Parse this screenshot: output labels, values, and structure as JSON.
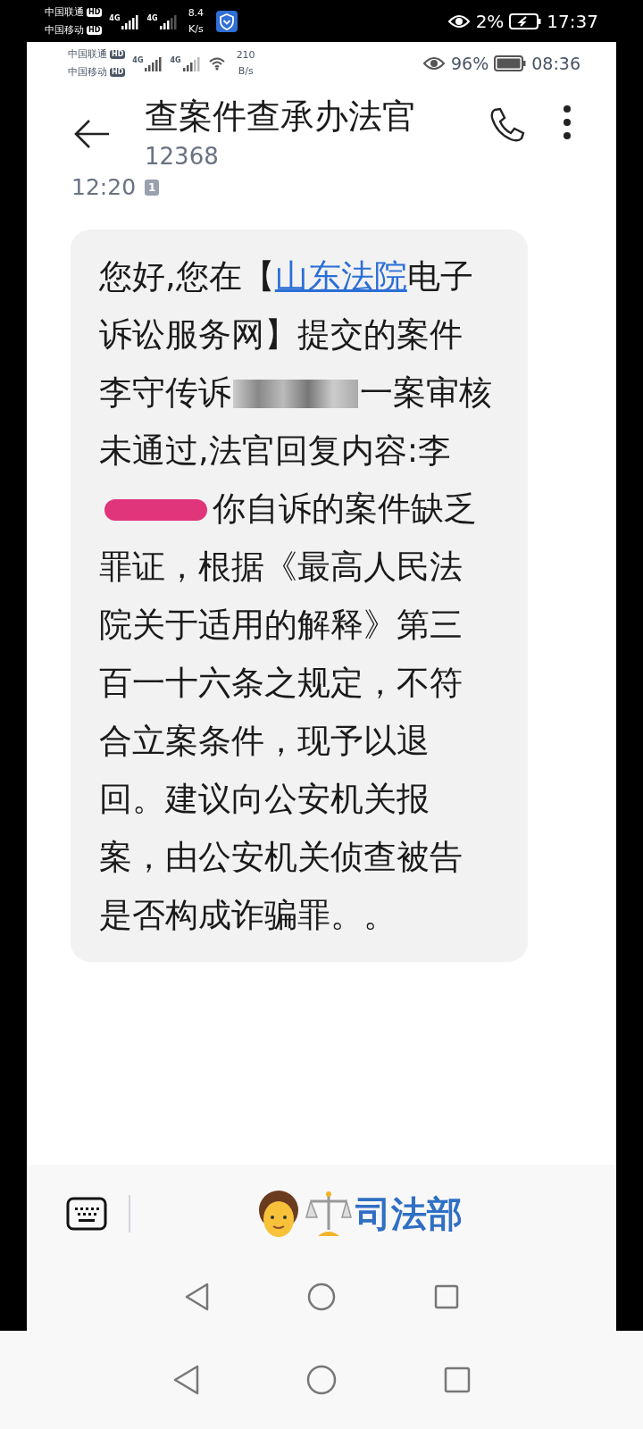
{
  "outer_status_bar": {
    "carrier_1": "中国联通",
    "carrier_2": "中国移动",
    "hd_1": "HD",
    "hd_2": "HD",
    "network_1": "4G",
    "network_2": "4G",
    "speed_value": "8.4",
    "speed_unit": "K/s",
    "battery_percent": "2%",
    "time": "17:37"
  },
  "inner_status_bar": {
    "carrier_1": "中国联通",
    "carrier_2": "中国移动",
    "hd_1": "HD",
    "hd_2": "HD",
    "network_1": "4G",
    "network_2": "4G",
    "speed_value": "210",
    "speed_unit": "B/s",
    "battery_percent": "96%",
    "time": "08:36"
  },
  "header": {
    "title": "查案件查承办法官",
    "number": "12368"
  },
  "message": {
    "time": "12:20",
    "sim": "1",
    "segments": [
      {
        "kind": "text",
        "text": "您好,您在【"
      },
      {
        "kind": "link",
        "text": "山东法院"
      },
      {
        "kind": "text",
        "text": "电子诉讼服务网】提交的案件李守传诉"
      },
      {
        "kind": "pixelated"
      },
      {
        "kind": "text",
        "text": "一案审核未通过,法官回复内容:李"
      },
      {
        "kind": "scribble"
      },
      {
        "kind": "text",
        "text": "你自诉的案件缺乏罪证，根据《最高人民法院关于适用的解释》第三百一十六条之规定，不符合立案条件，现予以退回。建议向公安机关报案，由公安机关侦查被告是否构成诈骗罪。。"
      }
    ]
  },
  "bottom_bar": {
    "menu_label": "司法部"
  }
}
